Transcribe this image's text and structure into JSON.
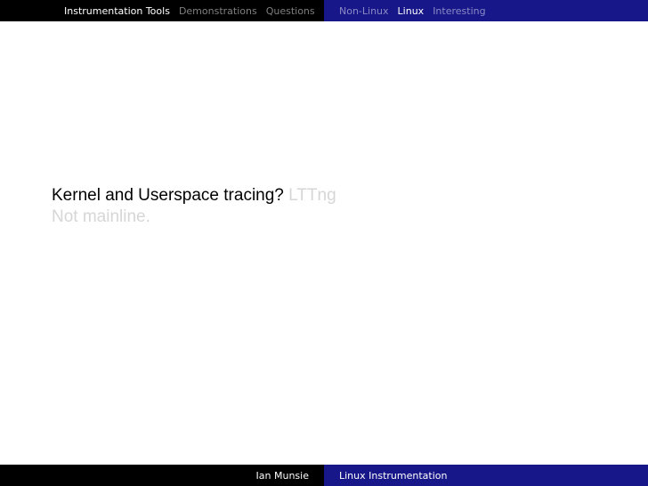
{
  "header": {
    "sections": [
      {
        "label": "Instrumentation Tools",
        "active": true
      },
      {
        "label": "Demonstrations",
        "active": false
      },
      {
        "label": "Questions",
        "active": false
      }
    ],
    "subsections": [
      {
        "label": "Non-Linux",
        "active": false
      },
      {
        "label": "Linux",
        "active": true
      },
      {
        "label": "Interesting",
        "active": false
      }
    ]
  },
  "slide": {
    "line1_question": "Kernel and Userspace tracing?",
    "line1_answer": "LTTng",
    "line2": "Not mainline."
  },
  "footer": {
    "author": "Ian Munsie",
    "title": "Linux Instrumentation"
  },
  "colors": {
    "left_bar": "#000000",
    "right_bar": "#17178a",
    "text": "#000000",
    "faded_text": "#d6d6d6"
  }
}
